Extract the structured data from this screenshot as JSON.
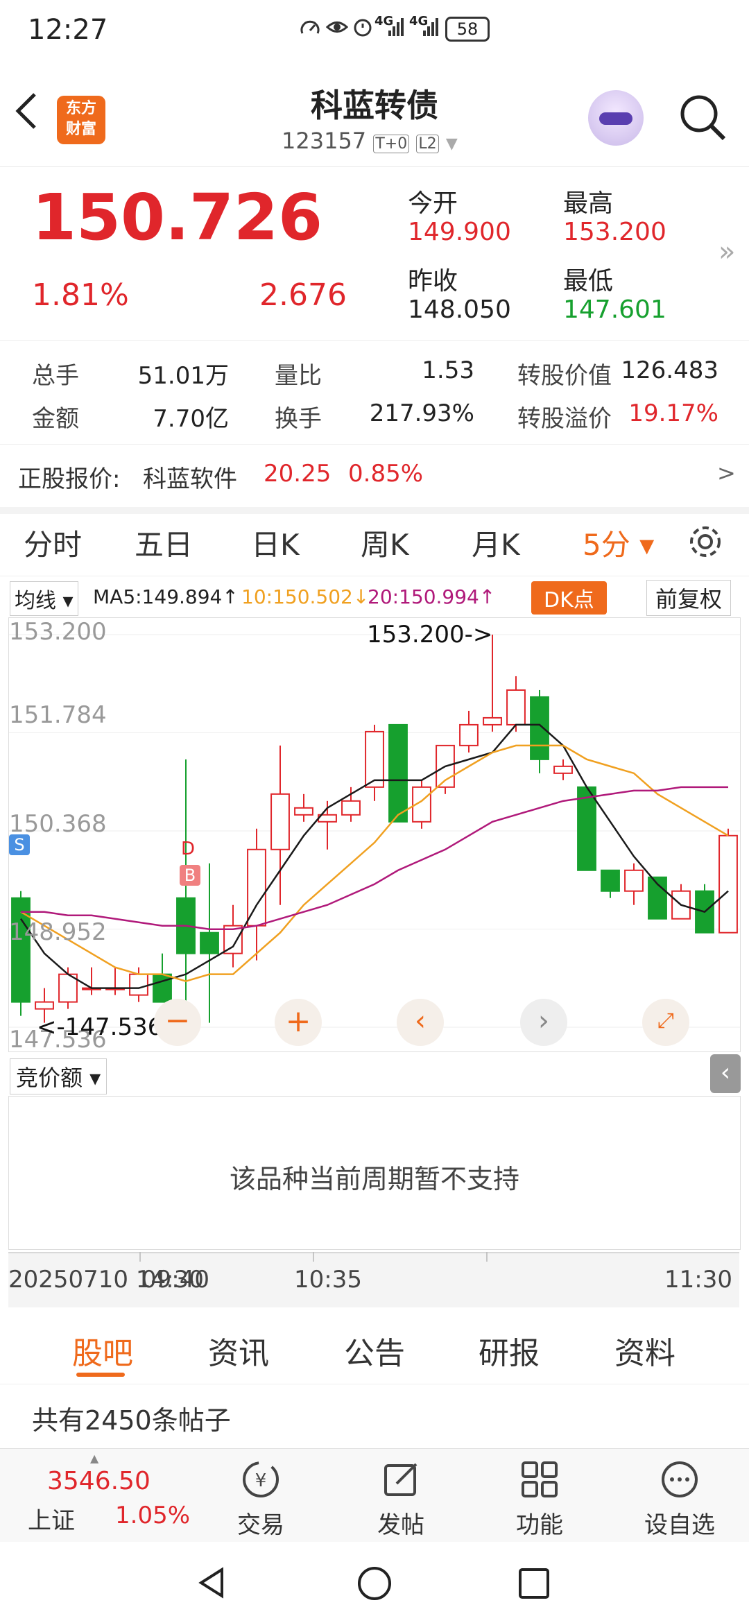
{
  "status": {
    "time": "12:27",
    "battery": "58",
    "net1": "4G",
    "net2": "4G"
  },
  "header": {
    "title": "科蓝转债",
    "code": "123157",
    "badge_t0": "T+0",
    "badge_l2": "L2",
    "logo_line1": "东方",
    "logo_line2": "财富"
  },
  "quote": {
    "price": "150.726",
    "pct": "1.81%",
    "change": "2.676",
    "open_label": "今开",
    "open": "149.900",
    "high_label": "最高",
    "high": "153.200",
    "prevclose_label": "昨收",
    "prevclose": "148.050",
    "low_label": "最低",
    "low": "147.601"
  },
  "stats": {
    "vol_label": "总手",
    "vol": "51.01万",
    "ratio_label": "量比",
    "ratio": "1.53",
    "convval_label": "转股价值",
    "convval": "126.483",
    "amount_label": "金额",
    "amount": "7.70亿",
    "turnover_label": "换手",
    "turnover": "217.93%",
    "premium_label": "转股溢价",
    "premium": "19.17%"
  },
  "underlying": {
    "label": "正股报价:",
    "name": "科蓝软件",
    "price": "20.25",
    "pct": "0.85%",
    "arrow": ">"
  },
  "periods": {
    "p1": "分时",
    "p2": "五日",
    "p3": "日K",
    "p4": "周K",
    "p5": "月K",
    "p6": "5分 ▾"
  },
  "ma_legend": {
    "select": "均线 ▾",
    "ma5": "MA5:149.894↑",
    "ma10": "10:150.502↓",
    "ma20": "20:150.994↑",
    "dk": "DK点",
    "adjust": "前复权"
  },
  "chart_labels": {
    "y1": "153.200",
    "y2": "151.784",
    "y3": "150.368",
    "y4": "148.952",
    "y5": "147.536",
    "high_mark": "153.200->",
    "low_mark": "<-147.536",
    "s_mark": "S",
    "d_mark": "D",
    "b_mark": "B"
  },
  "chart_data": {
    "type": "candlestick",
    "ylim": [
      147.536,
      153.2
    ],
    "y_ticks": [
      153.2,
      151.784,
      150.368,
      148.952,
      147.536
    ],
    "candles": [
      {
        "o": 149.4,
        "c": 147.9,
        "h": 149.5,
        "l": 147.7
      },
      {
        "o": 147.8,
        "c": 147.9,
        "h": 148.1,
        "l": 147.6
      },
      {
        "o": 147.9,
        "c": 148.3,
        "h": 148.4,
        "l": 147.8
      },
      {
        "o": 148.1,
        "c": 148.1,
        "h": 148.4,
        "l": 148.0
      },
      {
        "o": 148.1,
        "c": 148.1,
        "h": 148.4,
        "l": 148.0
      },
      {
        "o": 148.0,
        "c": 148.3,
        "h": 148.4,
        "l": 147.9
      },
      {
        "o": 148.3,
        "c": 147.9,
        "h": 148.6,
        "l": 147.9
      },
      {
        "o": 149.4,
        "c": 148.6,
        "h": 151.4,
        "l": 147.8
      },
      {
        "o": 148.9,
        "c": 148.6,
        "h": 149.9,
        "l": 147.6
      },
      {
        "o": 148.6,
        "c": 149.0,
        "h": 149.3,
        "l": 148.4
      },
      {
        "o": 149.0,
        "c": 150.1,
        "h": 150.4,
        "l": 148.5
      },
      {
        "o": 150.1,
        "c": 150.9,
        "h": 151.6,
        "l": 149.3
      },
      {
        "o": 150.6,
        "c": 150.7,
        "h": 150.9,
        "l": 150.5
      },
      {
        "o": 150.5,
        "c": 150.6,
        "h": 150.8,
        "l": 150.1
      },
      {
        "o": 150.6,
        "c": 150.8,
        "h": 151.0,
        "l": 150.5
      },
      {
        "o": 151.0,
        "c": 151.8,
        "h": 151.9,
        "l": 150.8
      },
      {
        "o": 151.9,
        "c": 150.5,
        "h": 151.9,
        "l": 150.5
      },
      {
        "o": 150.5,
        "c": 151.0,
        "h": 151.1,
        "l": 150.4
      },
      {
        "o": 151.0,
        "c": 151.6,
        "h": 151.6,
        "l": 150.9
      },
      {
        "o": 151.6,
        "c": 151.9,
        "h": 152.1,
        "l": 151.5
      },
      {
        "o": 151.9,
        "c": 152.0,
        "h": 153.2,
        "l": 151.8
      },
      {
        "o": 151.9,
        "c": 152.4,
        "h": 152.6,
        "l": 151.8
      },
      {
        "o": 152.3,
        "c": 151.4,
        "h": 152.4,
        "l": 151.2
      },
      {
        "o": 151.2,
        "c": 151.3,
        "h": 151.4,
        "l": 151.1
      },
      {
        "o": 151.0,
        "c": 149.8,
        "h": 151.0,
        "l": 149.8
      },
      {
        "o": 149.8,
        "c": 149.5,
        "h": 149.8,
        "l": 149.4
      },
      {
        "o": 149.5,
        "c": 149.8,
        "h": 149.9,
        "l": 149.3
      },
      {
        "o": 149.7,
        "c": 149.1,
        "h": 149.7,
        "l": 149.1
      },
      {
        "o": 149.1,
        "c": 149.5,
        "h": 149.6,
        "l": 149.1
      },
      {
        "o": 149.5,
        "c": 148.9,
        "h": 149.6,
        "l": 148.9
      },
      {
        "o": 148.9,
        "c": 150.3,
        "h": 150.4,
        "l": 148.9
      }
    ],
    "series": [
      {
        "name": "MA5",
        "color": "#1a1a1a",
        "values": [
          149.1,
          148.6,
          148.3,
          148.1,
          148.1,
          148.1,
          148.2,
          148.3,
          148.5,
          148.7,
          149.3,
          149.8,
          150.3,
          150.7,
          150.9,
          151.1,
          151.1,
          151.1,
          151.3,
          151.4,
          151.5,
          151.9,
          151.9,
          151.6,
          151.0,
          150.5,
          150.0,
          149.6,
          149.3,
          149.2,
          149.5
        ]
      },
      {
        "name": "MA10",
        "color": "#f0a020",
        "values": [
          149.2,
          149.0,
          148.8,
          148.6,
          148.4,
          148.3,
          148.3,
          148.2,
          148.3,
          148.3,
          148.6,
          148.9,
          149.3,
          149.6,
          149.9,
          150.2,
          150.6,
          150.8,
          151.1,
          151.3,
          151.5,
          151.6,
          151.6,
          151.6,
          151.4,
          151.3,
          151.2,
          150.9,
          150.7,
          150.5,
          150.3
        ]
      },
      {
        "name": "MA20",
        "color": "#b0197a",
        "values": [
          149.2,
          149.2,
          149.15,
          149.15,
          149.1,
          149.05,
          149.0,
          149.0,
          148.95,
          148.95,
          149.0,
          149.1,
          149.2,
          149.3,
          149.45,
          149.6,
          149.8,
          149.95,
          150.1,
          150.3,
          150.5,
          150.6,
          150.7,
          150.8,
          150.85,
          150.9,
          150.95,
          150.95,
          151.0,
          151.0,
          151.0
        ]
      }
    ]
  },
  "volume": {
    "select": "竞价额 ▾",
    "message": "该品种当前周期暂不支持"
  },
  "time_axis": {
    "date": "20250710 14:30",
    "t1": "09:40",
    "t2": "10:35",
    "t3": "11:30"
  },
  "tabs": {
    "t1": "股吧",
    "t2": "资讯",
    "t3": "公告",
    "t4": "研报",
    "t5": "资料"
  },
  "posts": {
    "count": "共有2450条帖子"
  },
  "bottombar": {
    "index_value": "3546.50",
    "index_name": "上证",
    "index_pct": "1.05%",
    "trade": "交易",
    "post": "发帖",
    "func": "功能",
    "watch": "设自选"
  }
}
